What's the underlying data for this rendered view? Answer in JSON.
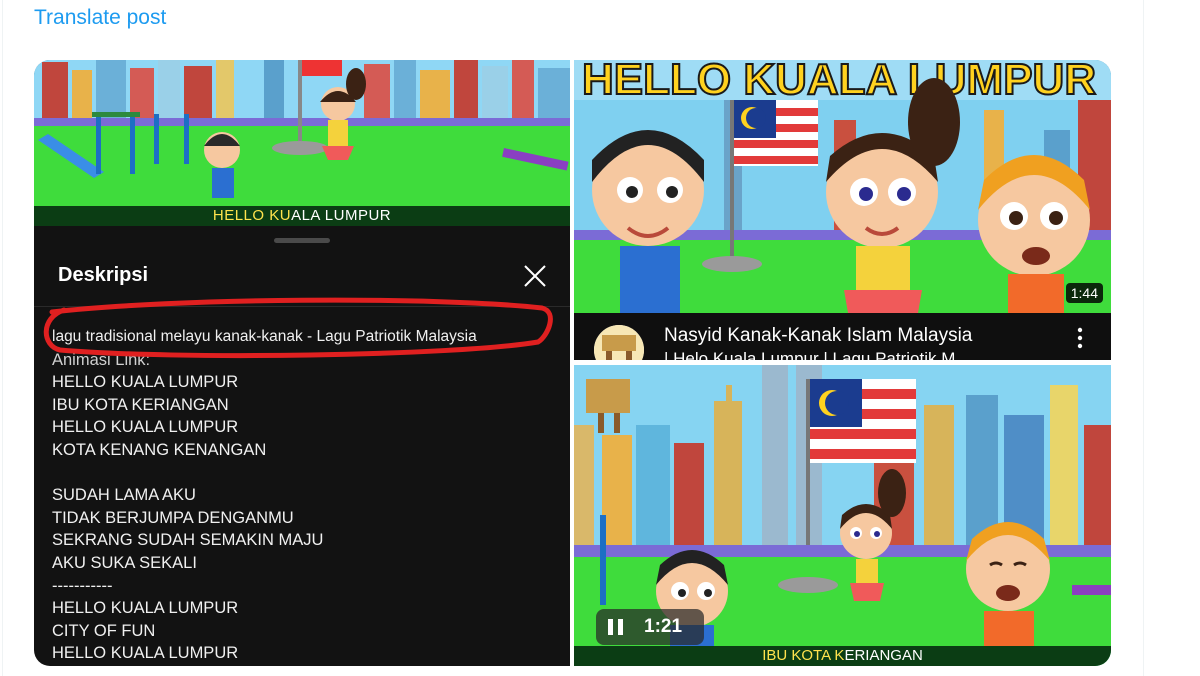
{
  "translate_label": "Translate post",
  "description_panel": {
    "video_caption_prefix": "HELLO KU",
    "video_caption_suffix": "ALA LUMPUR",
    "title": "Deskripsi",
    "lines": [
      "lagu tradisional melayu kanak-kanak - Lagu Patriotik Malaysia",
      "Animasi Link:",
      "HELLO KUALA LUMPUR",
      "IBU KOTA KERIANGAN",
      "HELLO KUALA LUMPUR",
      "KOTA KENANG KENANGAN",
      "",
      "SUDAH LAMA AKU",
      "TIDAK BERJUMPA DENGANMU",
      "SEKRANG SUDAH SEMAKIN MAJU",
      "AKU SUKA SEKALI",
      "-----------",
      "HELLO KUALA LUMPUR",
      "CITY OF FUN",
      "HELLO KUALA LUMPUR"
    ]
  },
  "video_card": {
    "banner_text": "HELLO KUALA LUMPUR",
    "duration": "1:44",
    "title": "Nasyid Kanak-Kanak Islam Malaysia",
    "subtitle": "| Helo Kuala Lumpur | Lagu Patriotik M"
  },
  "player": {
    "time": "1:21",
    "caption_prefix": "IBU KOTA K",
    "caption_suffix": "ERIANGAN"
  },
  "colors": {
    "link": "#1d9bf0",
    "sheet_bg": "#121212",
    "highlight_circle": "#e02020",
    "caption_highlight": "#ffe34d"
  }
}
